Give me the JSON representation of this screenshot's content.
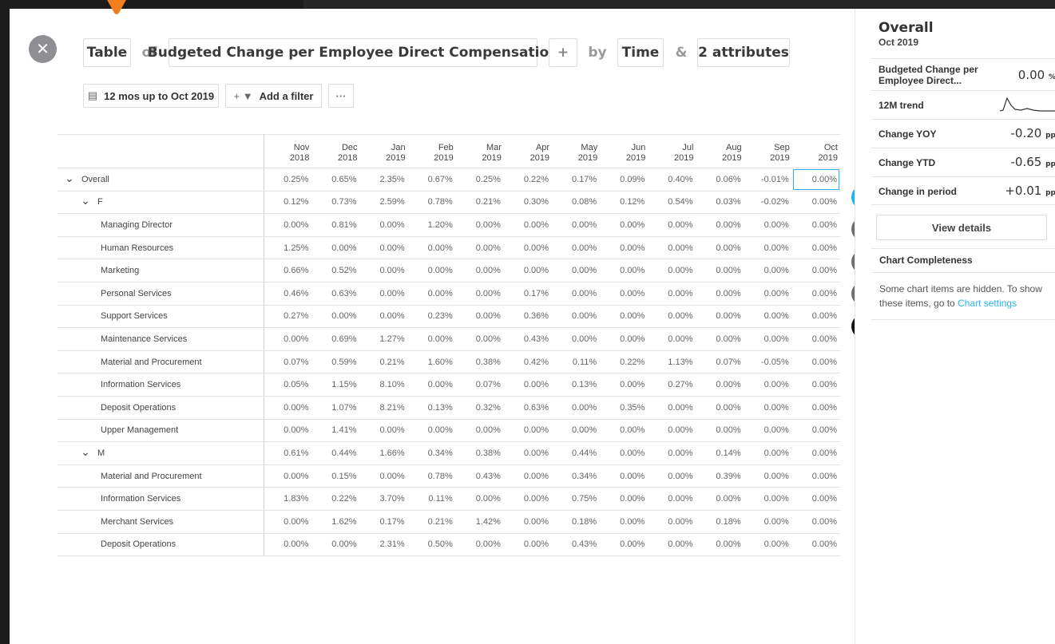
{
  "query": {
    "view": "Table",
    "of_word": "of",
    "metric": "Budgeted Change per Employee Direct Compensation",
    "plus": "+",
    "by_word": "by",
    "dimension": "Time",
    "and_word": "&",
    "attributes": "2 attributes"
  },
  "filters": {
    "period": "12 mos up to Oct 2019",
    "add_filter": "Add a filter",
    "more": "···"
  },
  "table": {
    "columns": [
      [
        "Nov",
        "2018"
      ],
      [
        "Dec",
        "2018"
      ],
      [
        "Jan",
        "2019"
      ],
      [
        "Feb",
        "2019"
      ],
      [
        "Mar",
        "2019"
      ],
      [
        "Apr",
        "2019"
      ],
      [
        "May",
        "2019"
      ],
      [
        "Jun",
        "2019"
      ],
      [
        "Jul",
        "2019"
      ],
      [
        "Aug",
        "2019"
      ],
      [
        "Sep",
        "2019"
      ],
      [
        "Oct",
        "2019"
      ]
    ],
    "rows": [
      {
        "label": "Overall",
        "level": 0,
        "caret": true,
        "values": [
          "0.25%",
          "0.65%",
          "2.35%",
          "0.67%",
          "0.25%",
          "0.22%",
          "0.17%",
          "0.09%",
          "0.40%",
          "0.06%",
          "-0.01%",
          "0.00%"
        ]
      },
      {
        "label": "F",
        "level": 1,
        "caret": true,
        "values": [
          "0.12%",
          "0.73%",
          "2.59%",
          "0.78%",
          "0.21%",
          "0.30%",
          "0.08%",
          "0.12%",
          "0.54%",
          "0.03%",
          "-0.02%",
          "0.00%"
        ]
      },
      {
        "label": "Managing Director",
        "level": 2,
        "caret": false,
        "values": [
          "0.00%",
          "0.81%",
          "0.00%",
          "1.20%",
          "0.00%",
          "0.00%",
          "0.00%",
          "0.00%",
          "0.00%",
          "0.00%",
          "0.00%",
          "0.00%"
        ]
      },
      {
        "label": "Human Resources",
        "level": 2,
        "caret": false,
        "values": [
          "1.25%",
          "0.00%",
          "0.00%",
          "0.00%",
          "0.00%",
          "0.00%",
          "0.00%",
          "0.00%",
          "0.00%",
          "0.00%",
          "0.00%",
          "0.00%"
        ]
      },
      {
        "label": "Marketing",
        "level": 2,
        "caret": false,
        "values": [
          "0.66%",
          "0.52%",
          "0.00%",
          "0.00%",
          "0.00%",
          "0.00%",
          "0.00%",
          "0.00%",
          "0.00%",
          "0.00%",
          "0.00%",
          "0.00%"
        ]
      },
      {
        "label": "Personal Services",
        "level": 2,
        "caret": false,
        "values": [
          "0.46%",
          "0.63%",
          "0.00%",
          "0.00%",
          "0.00%",
          "0.17%",
          "0.00%",
          "0.00%",
          "0.00%",
          "0.00%",
          "0.00%",
          "0.00%"
        ]
      },
      {
        "label": "Support Services",
        "level": 2,
        "caret": false,
        "values": [
          "0.27%",
          "0.00%",
          "0.00%",
          "0.23%",
          "0.00%",
          "0.36%",
          "0.00%",
          "0.00%",
          "0.00%",
          "0.00%",
          "0.00%",
          "0.00%"
        ]
      },
      {
        "label": "Maintenance Services",
        "level": 2,
        "caret": false,
        "values": [
          "0.00%",
          "0.69%",
          "1.27%",
          "0.00%",
          "0.00%",
          "0.43%",
          "0.00%",
          "0.00%",
          "0.00%",
          "0.00%",
          "0.00%",
          "0.00%"
        ]
      },
      {
        "label": "Material and Procurement",
        "level": 2,
        "caret": false,
        "values": [
          "0.07%",
          "0.59%",
          "0.21%",
          "1.60%",
          "0.38%",
          "0.42%",
          "0.11%",
          "0.22%",
          "1.13%",
          "0.07%",
          "-0.05%",
          "0.00%"
        ]
      },
      {
        "label": "Information Services",
        "level": 2,
        "caret": false,
        "values": [
          "0.05%",
          "1.15%",
          "8.10%",
          "0.00%",
          "0.07%",
          "0.00%",
          "0.13%",
          "0.00%",
          "0.27%",
          "0.00%",
          "0.00%",
          "0.00%"
        ]
      },
      {
        "label": "Deposit Operations",
        "level": 2,
        "caret": false,
        "values": [
          "0.00%",
          "1.07%",
          "8.21%",
          "0.13%",
          "0.32%",
          "0.63%",
          "0.00%",
          "0.35%",
          "0.00%",
          "0.00%",
          "0.00%",
          "0.00%"
        ]
      },
      {
        "label": "Upper Management",
        "level": 2,
        "caret": false,
        "values": [
          "0.00%",
          "1.41%",
          "0.00%",
          "0.00%",
          "0.00%",
          "0.00%",
          "0.00%",
          "0.00%",
          "0.00%",
          "0.00%",
          "0.00%",
          "0.00%"
        ]
      },
      {
        "label": "M",
        "level": 1,
        "caret": true,
        "values": [
          "0.61%",
          "0.44%",
          "1.66%",
          "0.34%",
          "0.38%",
          "0.00%",
          "0.44%",
          "0.00%",
          "0.00%",
          "0.14%",
          "0.00%",
          "0.00%"
        ]
      },
      {
        "label": "Material and Procurement",
        "level": 2,
        "caret": false,
        "values": [
          "0.00%",
          "0.15%",
          "0.00%",
          "0.78%",
          "0.43%",
          "0.00%",
          "0.34%",
          "0.00%",
          "0.00%",
          "0.39%",
          "0.00%",
          "0.00%"
        ]
      },
      {
        "label": "Information Services",
        "level": 2,
        "caret": false,
        "values": [
          "1.83%",
          "0.22%",
          "3.70%",
          "0.11%",
          "0.00%",
          "0.00%",
          "0.75%",
          "0.00%",
          "0.00%",
          "0.00%",
          "0.00%",
          "0.00%"
        ]
      },
      {
        "label": "Merchant Services",
        "level": 2,
        "caret": false,
        "values": [
          "0.00%",
          "1.62%",
          "0.17%",
          "0.21%",
          "1.42%",
          "0.00%",
          "0.18%",
          "0.00%",
          "0.00%",
          "0.18%",
          "0.00%",
          "0.00%"
        ]
      },
      {
        "label": "Deposit Operations",
        "level": 2,
        "caret": false,
        "values": [
          "0.00%",
          "0.00%",
          "2.31%",
          "0.50%",
          "0.00%",
          "0.00%",
          "0.43%",
          "0.00%",
          "0.00%",
          "0.00%",
          "0.00%",
          "0.00%"
        ]
      }
    ],
    "selected_cell": {
      "row": 0,
      "col": 11
    }
  },
  "side_panel": {
    "title": "Overall",
    "subtitle": "Oct 2019",
    "metric_label": "Budgeted Change per Employee Direct...",
    "metric_value": "0.00",
    "metric_unit": "%",
    "trend_label": "12M trend",
    "yoy_label": "Change YOY",
    "yoy_value": "-0.20",
    "yoy_unit": "pp",
    "ytd_label": "Change YTD",
    "ytd_value": "-0.65",
    "ytd_unit": "pp",
    "period_label": "Change in period",
    "period_value": "+0.01",
    "period_unit": "pp",
    "details_button": "View details",
    "completeness_heading": "Chart Completeness",
    "completeness_text": "Some chart items are hidden. To show these items, go to ",
    "completeness_link": "Chart settings"
  },
  "icons": {
    "close": "close-icon",
    "calendar": "calendar-icon",
    "filter": "filter-icon",
    "info": "info-icon",
    "table": "table-icon",
    "gear": "gear-icon",
    "download": "download-icon",
    "fit": "fit-screen-icon"
  },
  "colors": {
    "accent": "#25b3ea",
    "marker": "#f07f1c",
    "fab_gray": "#6e6e6e"
  }
}
